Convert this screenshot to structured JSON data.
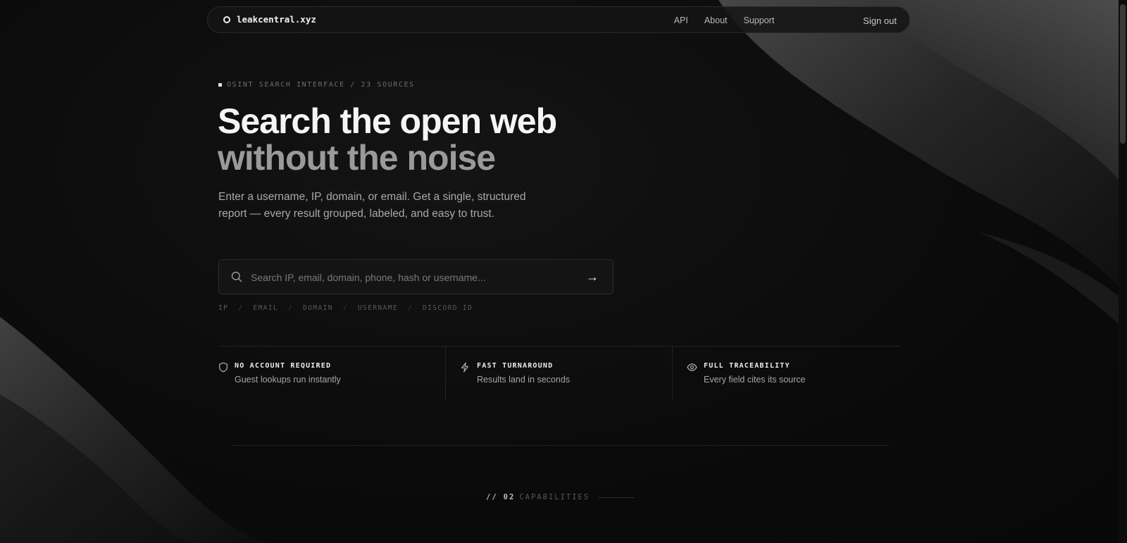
{
  "nav": {
    "brand": "leakcentral.xyz",
    "links": [
      "API",
      "About",
      "Support"
    ],
    "sign_out": "Sign out"
  },
  "hero": {
    "eyebrow": "OSINT SEARCH INTERFACE / 23 SOURCES",
    "headline_line1": "Search the open web",
    "headline_line2": "without the noise",
    "lede": "Enter a username, IP, domain, or email. Get a single, structured report — every result grouped, labeled, and easy to trust."
  },
  "search": {
    "placeholder": "Search IP, email, domain, phone, hash or username...",
    "value": "",
    "submit_glyph": "→",
    "types": [
      "IP",
      "EMAIL",
      "DOMAIN",
      "USERNAME",
      "DISCORD ID"
    ]
  },
  "features": [
    {
      "icon": "shield-icon",
      "title": "NO ACCOUNT REQUIRED",
      "desc": "Guest lookups run instantly"
    },
    {
      "icon": "lightning-icon",
      "title": "FAST TURNAROUND",
      "desc": "Results land in seconds"
    },
    {
      "icon": "eye-icon",
      "title": "FULL TRACEABILITY",
      "desc": "Every field cites its source"
    }
  ],
  "section": {
    "prefix": "//",
    "number": "02",
    "label": "CAPABILITIES"
  }
}
